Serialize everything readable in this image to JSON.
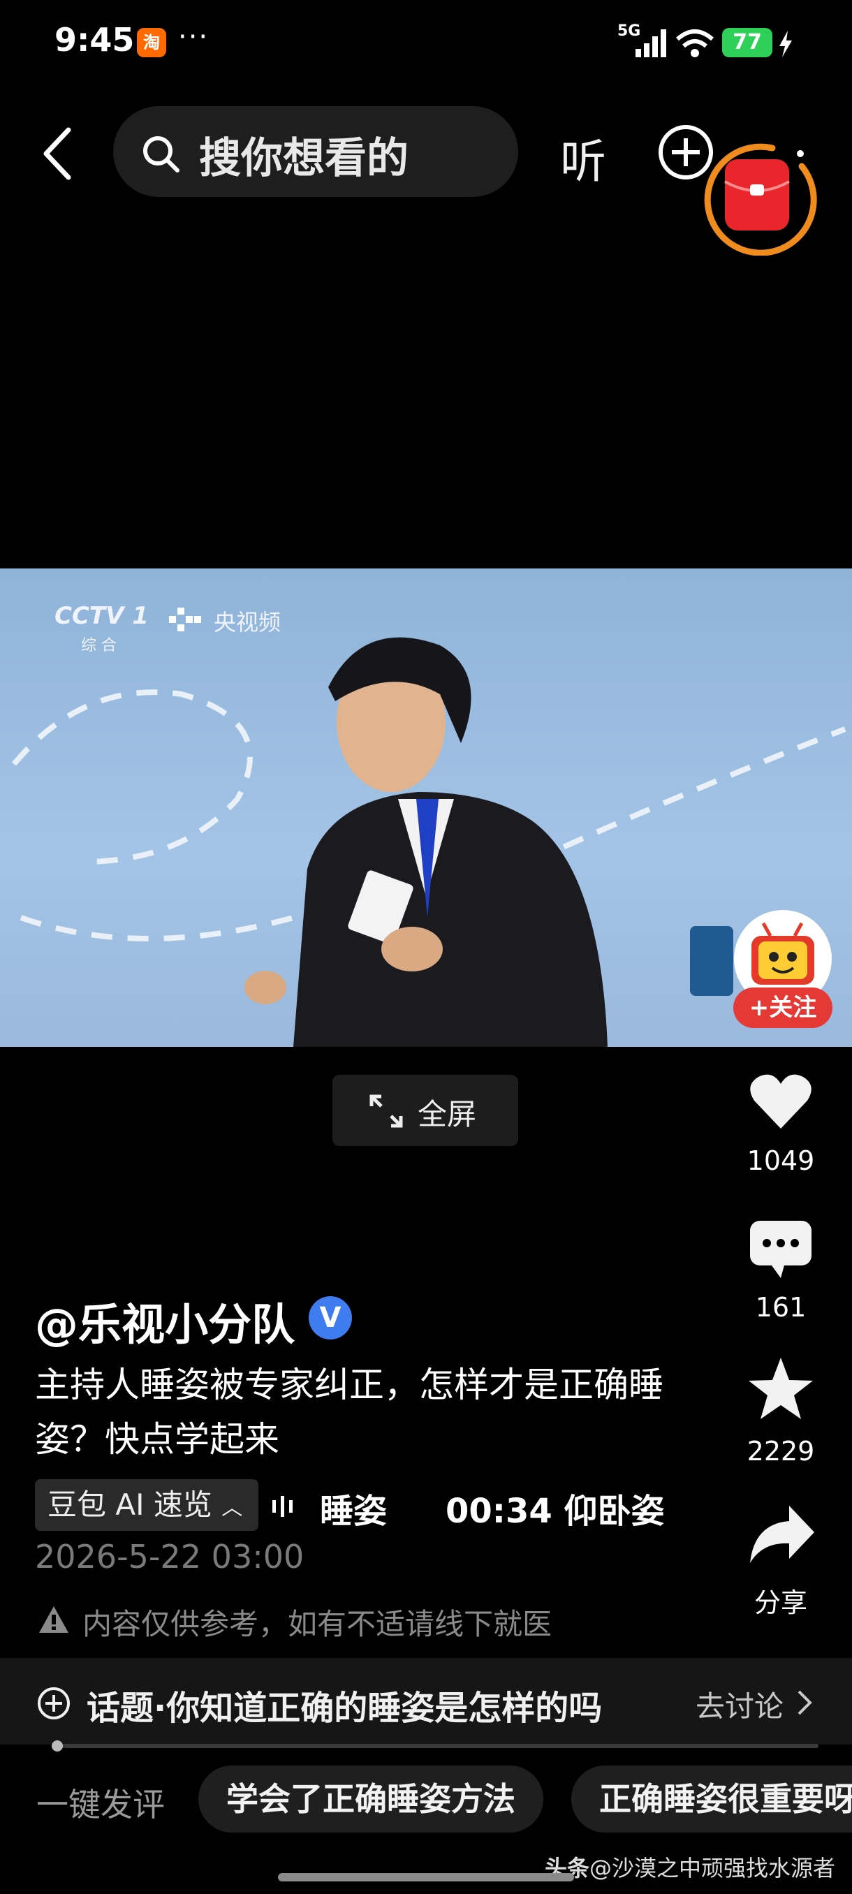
{
  "status_bar": {
    "time": "9:45",
    "app_icon_label": "淘",
    "overflow": "···",
    "network": "5G",
    "battery": "77"
  },
  "top_bar": {
    "search_placeholder": "搜你想看的",
    "listen_label": "听"
  },
  "video": {
    "channel_logo": "CCTV 1",
    "channel_sub": "综 合",
    "platform": "央视频",
    "follow_label": "+关注",
    "fullscreen_label": "全屏"
  },
  "actions": {
    "likes": "1049",
    "comments": "161",
    "favorites": "2229",
    "share_label": "分享"
  },
  "post": {
    "author": "@乐视小分队",
    "verified": "V",
    "description": "主持人睡姿被专家纠正，怎样才是正确睡姿？快点学起来",
    "ai_summary_label": "豆包 AI 速览",
    "chapters": [
      "睡姿",
      "00:34 仰卧姿"
    ],
    "date": "2026-5-22 03:00",
    "disclaimer": "内容仅供参考，如有不适请线下就医"
  },
  "topic": {
    "label": "话题·你知道正确的睡姿是怎样的吗",
    "action": "去讨论"
  },
  "quick_comment": {
    "label": "一键发评",
    "suggestions": [
      "学会了正确睡姿方法",
      "正确睡姿很重要呀"
    ]
  },
  "watermark": {
    "source": "头条",
    "handle": "@沙漠之中顽强找水源者"
  },
  "colors": {
    "verified": "#3f7cf0",
    "battery": "#2fd058",
    "follow": "#e53935",
    "redpacket": "#e8262c",
    "ring": "#f08c1e"
  }
}
